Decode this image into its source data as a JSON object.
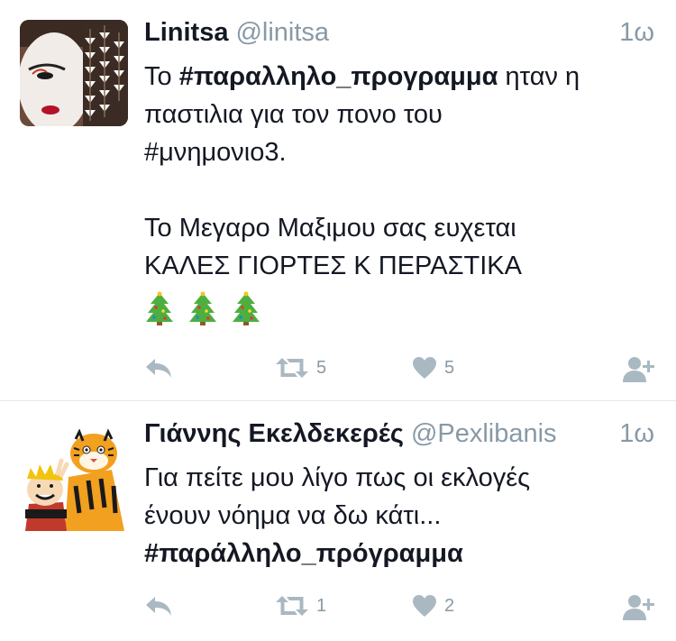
{
  "tweets": [
    {
      "name": "Linitsa",
      "handle": "@linitsa",
      "time": "1ω",
      "text": {
        "l1_pre": "Το ",
        "l1_tag": "#παραλληλο_προγραμμα",
        "l1_post": " ηταν η",
        "l2": "παστιλια για τον πονο του",
        "l3": "#μνημονιο3.",
        "l4": "Το Μεγαρο Μαξιμου σας ευχεται",
        "l5": "ΚΑΛΕΣ ΓΙΟΡΤΕΣ Κ ΠΕΡΑΣΤΙΚΑ",
        "emoji": [
          "christmas-tree",
          "christmas-tree",
          "christmas-tree"
        ]
      },
      "retweets": "5",
      "likes": "5"
    },
    {
      "name": "Γιάννης Εκελδεκερές",
      "handle": "@Pexlibanis",
      "time": "1ω",
      "text": {
        "l1": "Για πείτε μου λίγο πως οι εκλογές",
        "l2": "ένουν νόημα να δω κάτι...",
        "l3_tag": "#παράλληλο_πρόγραμμα"
      },
      "retweets": "1",
      "likes": "2"
    }
  ],
  "colors": {
    "icon": "#aab8c2",
    "muted": "#8899a6",
    "text": "#141823",
    "divider": "#e1e8ed"
  },
  "icons": [
    "reply-icon",
    "retweet-icon",
    "heart-icon",
    "follow-icon"
  ]
}
